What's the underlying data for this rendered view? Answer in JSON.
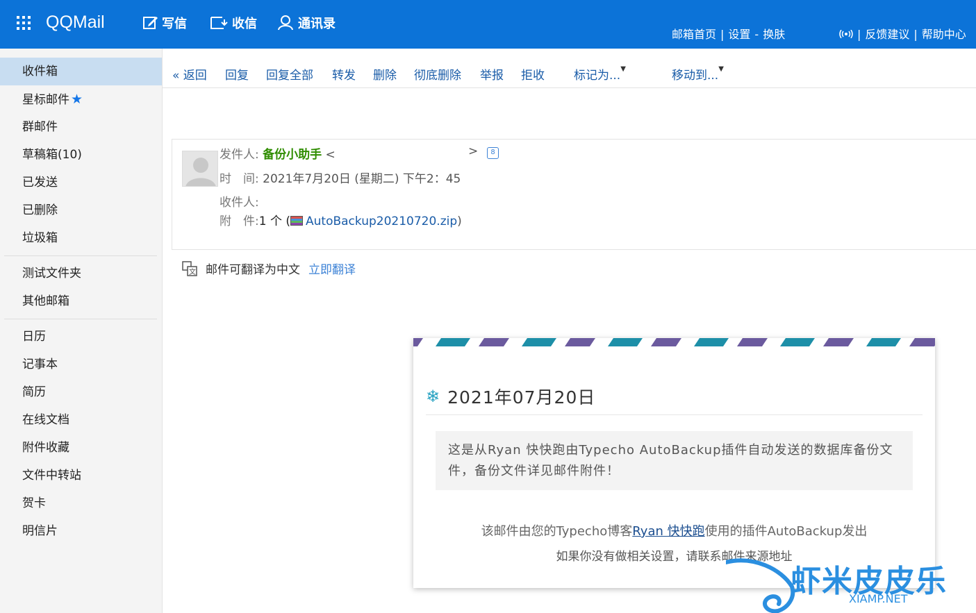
{
  "app": {
    "logo": "QQMail"
  },
  "nav": {
    "compose": "写信",
    "inbox": "收信",
    "contacts": "通讯录"
  },
  "toplinks": {
    "home": "邮箱首页",
    "settings": "设置",
    "dash": "-",
    "skin": "换肤",
    "feedback": "反馈建议",
    "help": "帮助中心",
    "bar": "|"
  },
  "sidebar": {
    "items": [
      "收件箱",
      "星标邮件",
      "群邮件",
      "草稿箱(10)",
      "已发送",
      "已删除",
      "垃圾箱"
    ],
    "folders": [
      "测试文件夹",
      "其他邮箱"
    ],
    "tools": [
      "日历",
      "记事本",
      "简历",
      "在线文档",
      "附件收藏",
      "文件中转站",
      "贺卡",
      "明信片"
    ],
    "active": "收件箱"
  },
  "toolbar": {
    "back": "« 返回",
    "reply": "回复",
    "reply_all": "回复全部",
    "forward": "转发",
    "delete": "删除",
    "delete_forever": "彻底删除",
    "report": "举报",
    "reject": "拒收",
    "mark_as": "标记为...",
    "move_to": "移动到..."
  },
  "header": {
    "from_label": "发件人:",
    "from_name": "备份小助手",
    "from_open": "<",
    "from_close": ">",
    "time_label": "时　间:",
    "time_value": "2021年7月20日 (星期二) 下午2：45",
    "to_label": "收件人:",
    "attach_label": "附　件:",
    "attach_count": "1 个 (",
    "attach_name": "AutoBackup20210720.zip",
    "attach_close": ")"
  },
  "translate": {
    "text": "邮件可翻译为中文",
    "action": "立即翻译"
  },
  "card": {
    "date": "2021年07月20日",
    "body": "这是从Ryan 快快跑由Typecho AutoBackup插件自动发送的数据库备份文件，备份文件详见邮件附件！",
    "foot1_pre": "该邮件由您的Typecho博客",
    "foot1_link": "Ryan 快快跑",
    "foot1_post": "使用的插件AutoBackup发出",
    "foot2": "如果你没有做相关设置，请联系邮件来源地址"
  },
  "watermark": {
    "brand": "虾米皮皮乐",
    "site": "XIAMP.NET"
  },
  "colors": {
    "topbar": "#0c73d8",
    "active": "#c8ddf1",
    "link": "#1a5ca8",
    "sender": "#2f8d00",
    "stripe_teal": "#1d8fa8",
    "stripe_purple": "#6b5a9e"
  },
  "icons": [
    "apps-grid-icon",
    "compose-icon",
    "inbox-icon",
    "contacts-icon",
    "star-icon",
    "radio-icon",
    "contact-card-icon",
    "zip-file-icon",
    "translate-icon",
    "snowflake-icon",
    "shrimp-logo-icon"
  ]
}
